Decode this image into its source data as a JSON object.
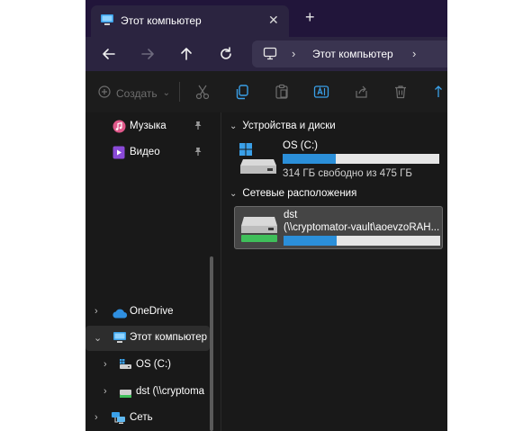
{
  "window": {
    "tab": {
      "title": "Этот компьютер",
      "close_glyph": "✕",
      "icon": "this-pc-icon"
    },
    "new_tab_glyph": "+"
  },
  "address_bar": {
    "location": "Этот компьютер",
    "chevron": "›"
  },
  "toolbar": {
    "create_label": "Создать",
    "create_chevron": "⌄"
  },
  "navigation": {
    "items": [
      {
        "label": "Музыка",
        "icon": "music-icon",
        "pinned": true
      },
      {
        "label": "Видео",
        "icon": "video-icon",
        "pinned": true
      },
      {
        "label": "OneDrive",
        "icon": "onedrive-cloud-icon",
        "chevron": "›"
      },
      {
        "label": "Этот компьютер",
        "icon": "this-pc-icon",
        "chevron": "⌄",
        "selected": true
      },
      {
        "label": "OS (C:)",
        "icon": "os-drive-icon",
        "chevron": "›"
      },
      {
        "label": "dst (\\\\cryptoma",
        "icon": "network-drive-icon",
        "chevron": "›"
      },
      {
        "label": "Сеть",
        "icon": "network-icon",
        "chevron": "›"
      }
    ],
    "pin_glyph": "📌"
  },
  "content": {
    "devices_group": {
      "label": "Устройства и диски",
      "chevron": "⌄"
    },
    "network_group": {
      "label": "Сетевые расположения",
      "chevron": "⌄"
    },
    "drives": [
      {
        "name": "OS (C:)",
        "free_text": "314 ГБ свободно из 475 ГБ",
        "used_fraction": 0.34
      },
      {
        "name_line1": "dst",
        "name_line2": "(\\\\cryptomator-vault\\aoevzoRAH...",
        "used_fraction": 0.34
      }
    ]
  },
  "colors": {
    "titlebar": "#21153a",
    "addressbar": "#2b2440",
    "background": "#191919",
    "accent": "#2b8fd9"
  }
}
